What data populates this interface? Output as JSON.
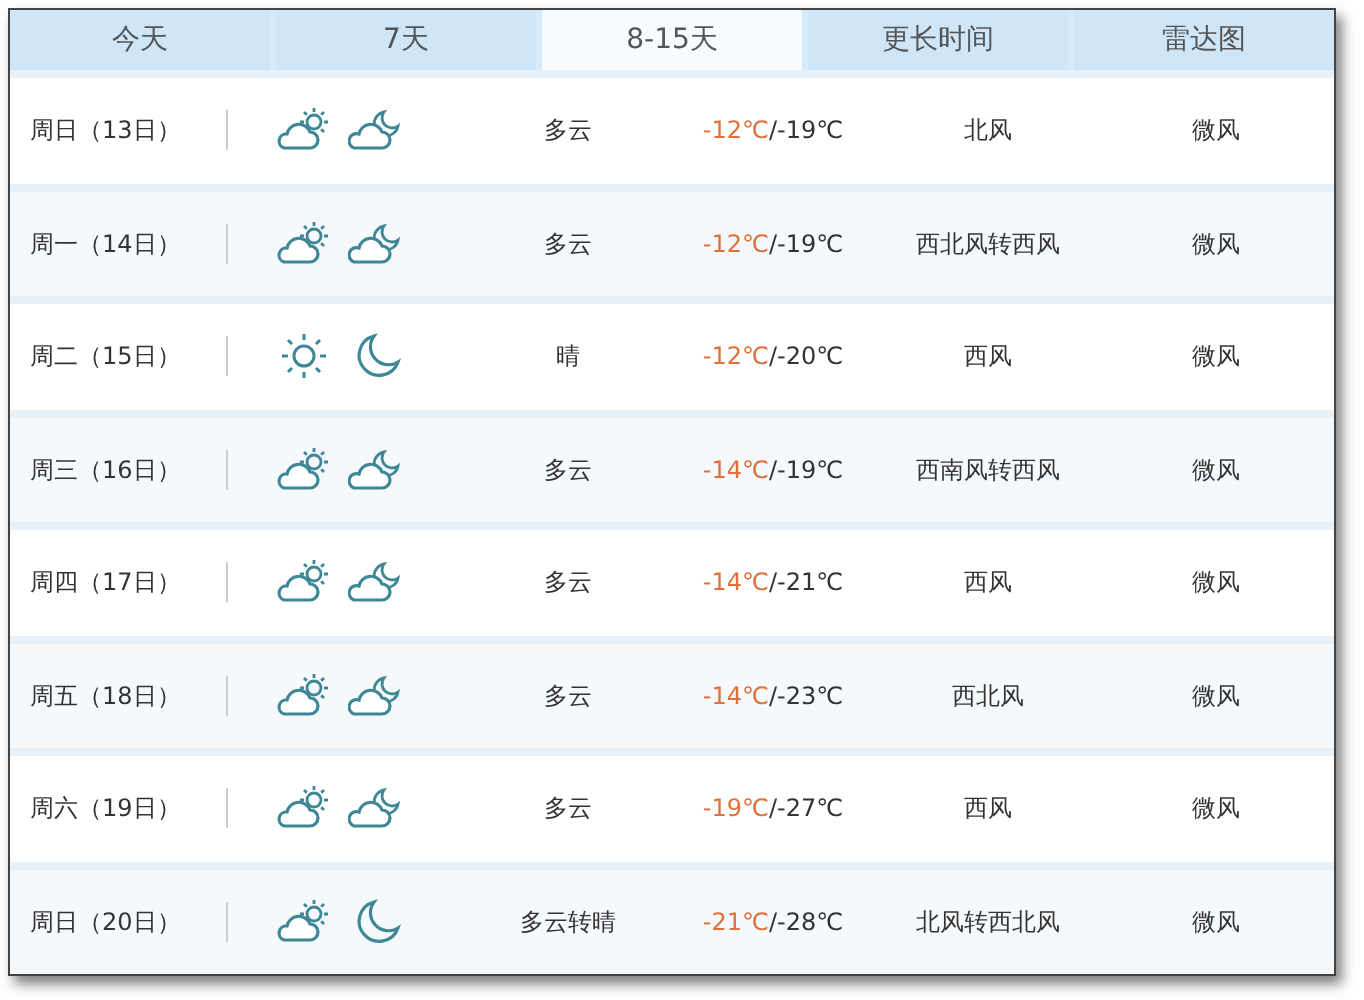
{
  "tabs": [
    {
      "label": "今天",
      "selected": false
    },
    {
      "label": "7天",
      "selected": false
    },
    {
      "label": "8-15天",
      "selected": true
    },
    {
      "label": "更长时间",
      "selected": false
    },
    {
      "label": "雷达图",
      "selected": false
    }
  ],
  "rows": [
    {
      "day": "周日（13日）",
      "icons": [
        {
          "kind": "sun-cloud"
        },
        {
          "kind": "moon-cloud"
        }
      ],
      "weather": "多云",
      "high": "-12℃",
      "low": "/-19℃",
      "wind": "北风",
      "wind_level": "微风"
    },
    {
      "day": "周一（14日）",
      "icons": [
        {
          "kind": "sun-cloud"
        },
        {
          "kind": "moon-cloud"
        }
      ],
      "weather": "多云",
      "high": "-12℃",
      "low": "/-19℃",
      "wind": "西北风转西风",
      "wind_level": "微风"
    },
    {
      "day": "周二（15日）",
      "icons": [
        {
          "kind": "sun"
        },
        {
          "kind": "moon"
        }
      ],
      "weather": "晴",
      "high": "-12℃",
      "low": "/-20℃",
      "wind": "西风",
      "wind_level": "微风"
    },
    {
      "day": "周三（16日）",
      "icons": [
        {
          "kind": "sun-cloud"
        },
        {
          "kind": "moon-cloud"
        }
      ],
      "weather": "多云",
      "high": "-14℃",
      "low": "/-19℃",
      "wind": "西南风转西风",
      "wind_level": "微风"
    },
    {
      "day": "周四（17日）",
      "icons": [
        {
          "kind": "sun-cloud"
        },
        {
          "kind": "moon-cloud"
        }
      ],
      "weather": "多云",
      "high": "-14℃",
      "low": "/-21℃",
      "wind": "西风",
      "wind_level": "微风"
    },
    {
      "day": "周五（18日）",
      "icons": [
        {
          "kind": "sun-cloud"
        },
        {
          "kind": "moon-cloud"
        }
      ],
      "weather": "多云",
      "high": "-14℃",
      "low": "/-23℃",
      "wind": "西北风",
      "wind_level": "微风"
    },
    {
      "day": "周六（19日）",
      "icons": [
        {
          "kind": "sun-cloud"
        },
        {
          "kind": "moon-cloud"
        }
      ],
      "weather": "多云",
      "high": "-19℃",
      "low": "/-27℃",
      "wind": "西风",
      "wind_level": "微风"
    },
    {
      "day": "周日（20日）",
      "icons": [
        {
          "kind": "sun-cloud"
        },
        {
          "kind": "moon"
        }
      ],
      "weather": "多云转晴",
      "high": "-21℃",
      "low": "/-28℃",
      "wind": "北风转西北风",
      "wind_level": "微风"
    }
  ]
}
